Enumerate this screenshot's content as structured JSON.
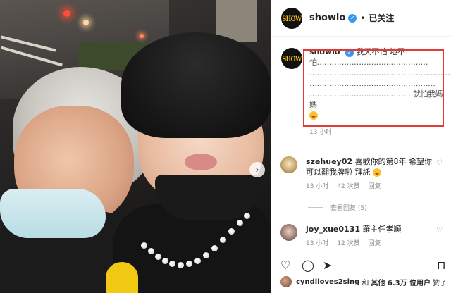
{
  "header": {
    "username": "showlo",
    "logo_text": "SHOW",
    "separator": "•",
    "follow_state": "已关注"
  },
  "caption": {
    "username": "showlo",
    "line1": "我天不怕 地不",
    "line2": "怕………………………………………",
    "line3": "…………………………………………………………",
    "line4": "……………………………………………",
    "line5": "……………………………………就怕我媽媽",
    "time": "13 小时"
  },
  "comments": [
    {
      "username": "szehuey02",
      "text": "喜歡你的第8年 希望你可以翻我牌啦 拜託",
      "time": "13 小时",
      "likes": "42 次赞",
      "reply": "回复",
      "view_replies": "查看回复 (5)"
    },
    {
      "username": "joy_xue0131",
      "text": "羅主任孝順",
      "time": "13 小时",
      "likes": "12 次赞",
      "reply": "回复"
    }
  ],
  "liked_by": {
    "user": "cyndiloves2sing",
    "and": "和",
    "others": "其他 6.3万 位用户",
    "suffix": "赞了"
  },
  "icons": {
    "heart": "heart-icon",
    "comment": "comment-icon",
    "share": "share-icon",
    "save": "bookmark-icon"
  },
  "colors": {
    "highlight_box": "#e53935",
    "verified": "#3897f0",
    "meta_text": "#8e8e8e"
  }
}
